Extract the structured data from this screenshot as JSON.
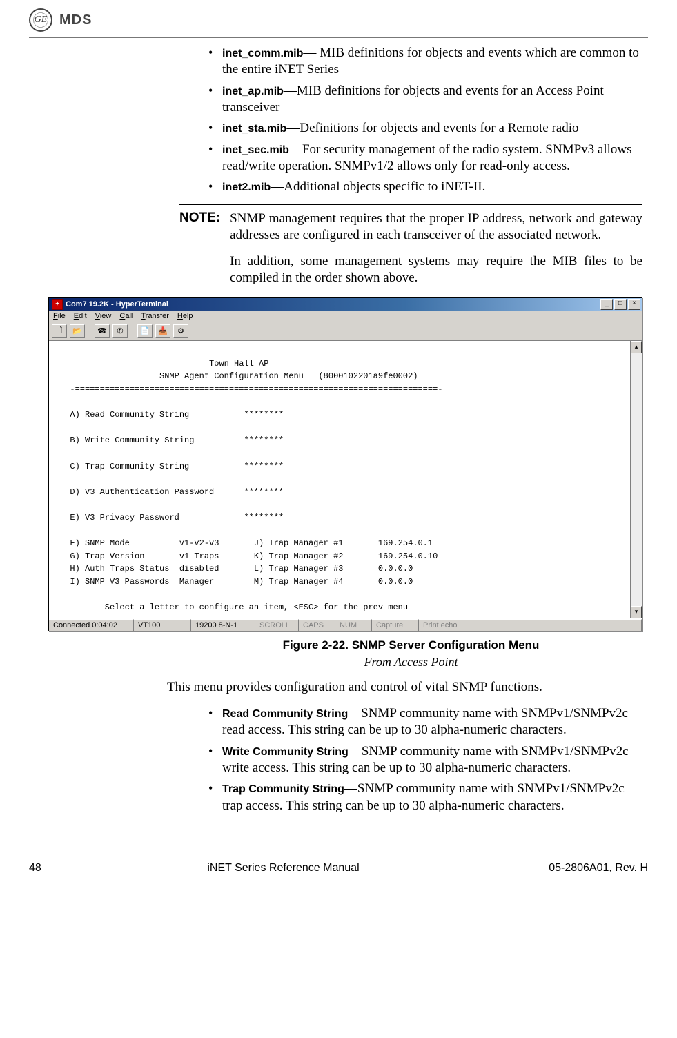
{
  "header": {
    "logo_text": "GE",
    "brand": "MDS"
  },
  "mib_list": [
    {
      "term": "inet_comm.mib",
      "desc": "— MIB definitions for objects and events which are common to the entire iNET Series"
    },
    {
      "term": "inet_ap.mib",
      "desc": "—MIB definitions for objects and events for an Access Point transceiver"
    },
    {
      "term": "inet_sta.mib",
      "desc": "—Definitions for objects and events for a Remote radio"
    },
    {
      "term": "inet_sec.mib",
      "desc": "—For security management of the radio system. SNMPv3 allows read/write operation. SNMPv1/2 allows only for read-only access."
    },
    {
      "term": "inet2.mib",
      "desc": "—Additional objects specific to iNET-II."
    }
  ],
  "note": {
    "label": "NOTE:",
    "p1": "SNMP management requires that the proper IP address, network and gateway addresses are configured in each transceiver of the associated network.",
    "p2": "In addition, some management systems may require the MIB files to be compiled in the order shown above."
  },
  "hyperterminal": {
    "title": "Com7 19.2K - HyperTerminal",
    "menus": [
      "File",
      "Edit",
      "View",
      "Call",
      "Transfer",
      "Help"
    ],
    "header1": "                              Town Hall AP",
    "header2": "                    SNMP Agent Configuration Menu   (8000102201a9fe0002)",
    "divider": "  -=========================================================================-",
    "rows_left": [
      "A) Read Community String           ********",
      "B) Write Community String          ********",
      "C) Trap Community String           ********",
      "D) V3 Authentication Password      ********",
      "E) V3 Privacy Password             ********",
      "F) SNMP Mode          v1-v2-v3       J) Trap Manager #1       169.254.0.1",
      "G) Trap Version       v1 Traps       K) Trap Manager #2       169.254.0.10",
      "H) Auth Traps Status  disabled       L) Trap Manager #3       0.0.0.0",
      "I) SNMP V3 Passwords  Manager        M) Trap Manager #4       0.0.0.0"
    ],
    "prompt": "         Select a letter to configure an item, <ESC> for the prev menu",
    "status": {
      "connected": "Connected 0:04:02",
      "emu": "VT100",
      "cfg": "19200 8-N-1",
      "scroll": "SCROLL",
      "caps": "CAPS",
      "num": "NUM",
      "capture": "Capture",
      "echo": "Print echo"
    }
  },
  "figure": {
    "caption": "Figure 2-22. SNMP Server Configuration Menu",
    "sub": "From Access Point"
  },
  "intro": "This menu provides configuration and control of vital SNMP functions.",
  "desc_list": [
    {
      "term": "Read Community String",
      "desc": "—SNMP community name with SNMPv1/SNMPv2c read access. This string can be up to 30 alpha-numeric characters."
    },
    {
      "term": "Write Community String",
      "desc": "—SNMP community name with SNMPv1/SNMPv2c write access. This string can be up to 30 alpha-numeric characters."
    },
    {
      "term": "Trap Community String",
      "desc": "—SNMP community name with SNMPv1/SNMPv2c trap access. This string can be up to 30 alpha-numeric characters."
    }
  ],
  "footer": {
    "page": "48",
    "title": "iNET Series Reference Manual",
    "doc": "05-2806A01, Rev. H"
  }
}
